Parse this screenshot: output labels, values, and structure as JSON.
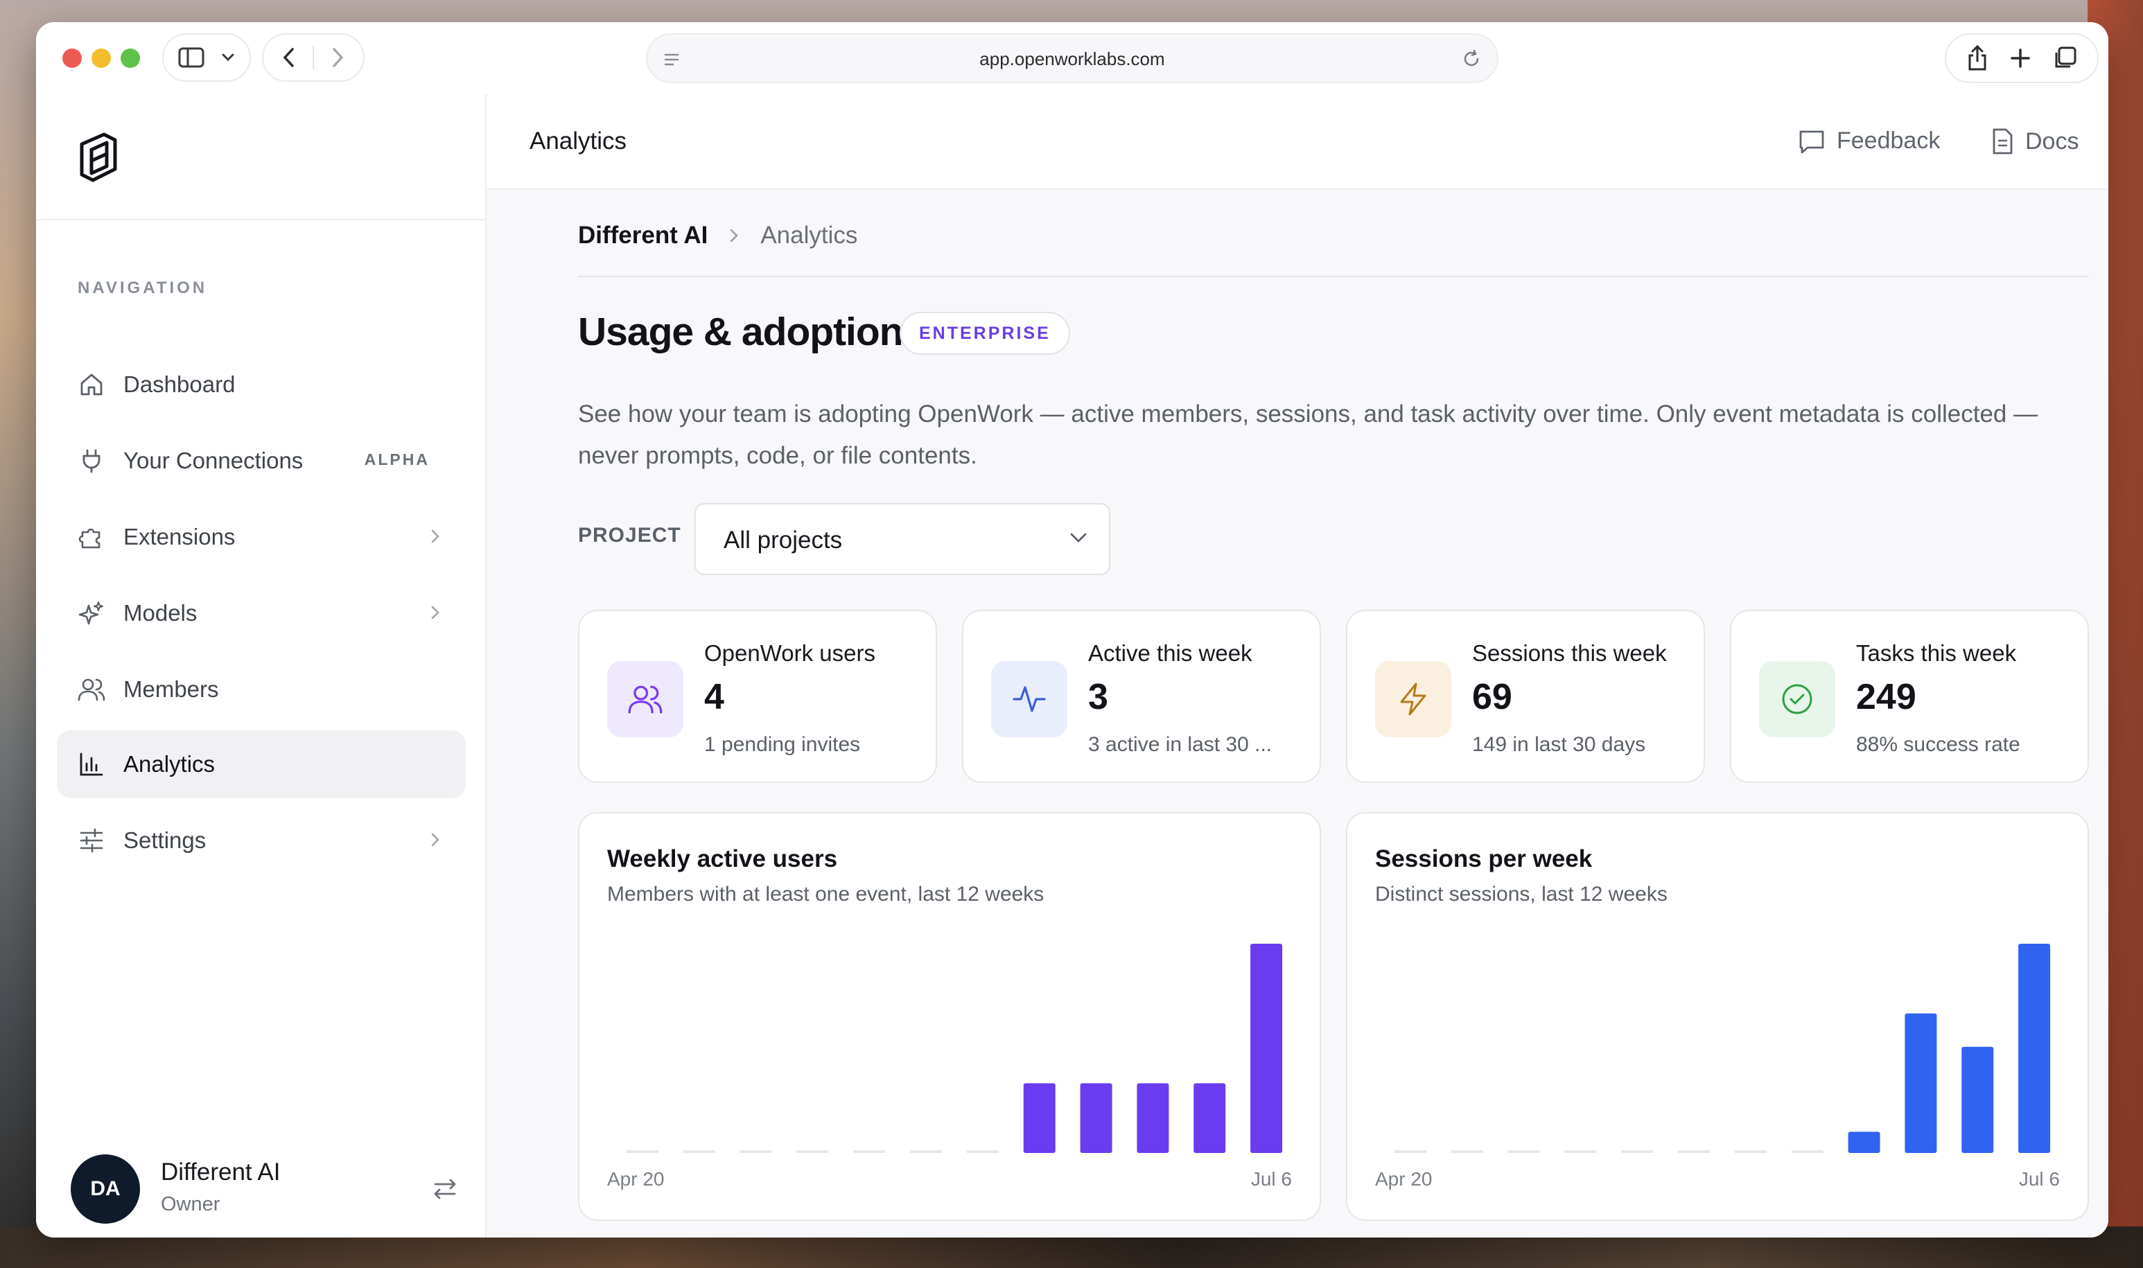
{
  "browser": {
    "url": "app.openworklabs.com"
  },
  "sidebar": {
    "nav_heading": "NAVIGATION",
    "items": [
      {
        "label": "Dashboard",
        "icon": "home-icon"
      },
      {
        "label": "Your Connections",
        "badge": "ALPHA",
        "icon": "plug-icon"
      },
      {
        "label": "Extensions",
        "icon": "puzzle-icon",
        "has_submenu": true
      },
      {
        "label": "Models",
        "icon": "sparkles-icon",
        "has_submenu": true
      },
      {
        "label": "Members",
        "icon": "users-icon"
      },
      {
        "label": "Analytics",
        "icon": "bar-chart-icon",
        "active": true
      },
      {
        "label": "Settings",
        "icon": "sliders-icon",
        "has_submenu": true
      }
    ],
    "user": {
      "initials": "DA",
      "name": "Different AI",
      "role": "Owner"
    }
  },
  "header": {
    "title": "Analytics",
    "links": {
      "feedback": "Feedback",
      "docs": "Docs"
    }
  },
  "breadcrumb": {
    "org": "Different AI",
    "page": "Analytics"
  },
  "page": {
    "title": "Usage & adoption",
    "badge": "ENTERPRISE",
    "description": "See how your team is adopting OpenWork — active members, sessions, and task activity over time. Only event metadata is collected — never prompts, code, or file contents.",
    "project_label": "PROJECT",
    "project_selected": "All projects"
  },
  "stats": [
    {
      "title": "OpenWork users",
      "value": "4",
      "sub": "1 pending invites",
      "icon": "users-icon",
      "color": "#7c3aed",
      "bg": "#efe9fd"
    },
    {
      "title": "Active this week",
      "value": "3",
      "sub": "3 active in last 30 ...",
      "icon": "activity-icon",
      "color": "#3b5bdb",
      "bg": "#e8eefc"
    },
    {
      "title": "Sessions this week",
      "value": "69",
      "sub": "149 in last 30 days",
      "icon": "lightning-icon",
      "color": "#b7791f",
      "bg": "#fbf0df"
    },
    {
      "title": "Tasks this week",
      "value": "249",
      "sub": "88% success rate",
      "icon": "check-circle-icon",
      "color": "#2f9e44",
      "bg": "#e7f5ea"
    }
  ],
  "chart_data": [
    {
      "type": "bar",
      "title": "Weekly active users",
      "subtitle": "Members with at least one event, last 12 weeks",
      "x_start_label": "Apr 20",
      "x_end_label": "Jul 6",
      "values": [
        0,
        0,
        0,
        0,
        0,
        0,
        0,
        3,
        3,
        3,
        3,
        9
      ],
      "ylim": [
        0,
        9
      ],
      "color": "#6a3cf0"
    },
    {
      "type": "bar",
      "title": "Sessions per week",
      "subtitle": "Distinct sessions, last 12 weeks",
      "x_start_label": "Apr 20",
      "x_end_label": "Jul 6",
      "values": [
        0,
        0,
        0,
        0,
        0,
        0,
        0,
        0,
        7,
        46,
        35,
        69
      ],
      "ylim": [
        0,
        69
      ],
      "color": "#2f63f0"
    }
  ]
}
